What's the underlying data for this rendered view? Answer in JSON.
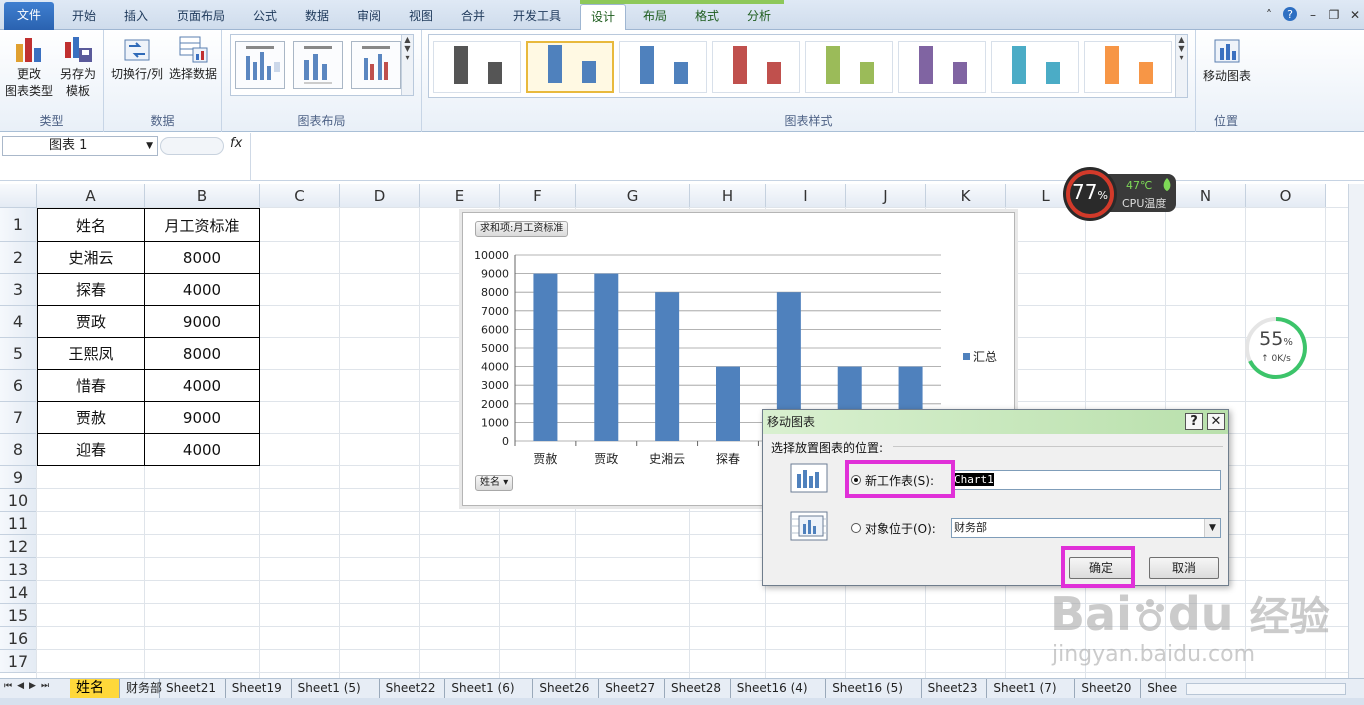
{
  "tabs": [
    "文件",
    "开始",
    "插入",
    "页面布局",
    "公式",
    "数据",
    "审阅",
    "视图",
    "合并",
    "开发工具",
    "设计",
    "布局",
    "格式",
    "分析"
  ],
  "ribbon": {
    "group_type": {
      "label": "类型",
      "change_type": "更改\n图表类型",
      "save_template": "另存为\n模板"
    },
    "group_data": {
      "label": "数据",
      "switch": "切换行/列",
      "select": "选择数据"
    },
    "group_layout": {
      "label": "图表布局"
    },
    "group_styles": {
      "label": "图表样式",
      "style_colors": [
        "#555555",
        "#4f81bd",
        "#4f81bd",
        "#c0504d",
        "#9bbb59",
        "#8064a2",
        "#4bacc6",
        "#f79646"
      ]
    },
    "group_location": {
      "label": "位置",
      "move_chart": "移动图表"
    }
  },
  "namebox": {
    "value": "图表 1"
  },
  "fx": "fx",
  "columns": [
    "A",
    "B",
    "C",
    "D",
    "E",
    "F",
    "G",
    "H",
    "I",
    "J",
    "K",
    "L",
    "M",
    "N",
    "O"
  ],
  "rows": [
    "1",
    "2",
    "3",
    "4",
    "5",
    "6",
    "7",
    "8",
    "9",
    "10",
    "11",
    "12",
    "13",
    "14",
    "15",
    "16",
    "17"
  ],
  "table": {
    "headers": [
      "姓名",
      "月工资标准"
    ],
    "rows": [
      [
        "史湘云",
        "8000"
      ],
      [
        "探春",
        "4000"
      ],
      [
        "贾政",
        "9000"
      ],
      [
        "王熙凤",
        "8000"
      ],
      [
        "惜春",
        "4000"
      ],
      [
        "贾赦",
        "9000"
      ],
      [
        "迎春",
        "4000"
      ]
    ]
  },
  "chart_data": {
    "type": "bar",
    "title": "",
    "value_field_button": "求和项:月工资标准",
    "axis_field_button": "姓名",
    "categories": [
      "贾赦",
      "贾政",
      "史湘云",
      "探春",
      "",
      "",
      ""
    ],
    "series": [
      {
        "name": "汇总",
        "values": [
          9000,
          9000,
          8000,
          4000,
          8000,
          4000,
          4000
        ],
        "color": "#4f81bd"
      }
    ],
    "ylim": [
      0,
      10000
    ],
    "yticks": [
      "10000",
      "9000",
      "8000",
      "7000",
      "6000",
      "5000",
      "4000",
      "3000",
      "2000",
      "1000",
      "0"
    ],
    "grid": true,
    "legend": "right"
  },
  "dialog": {
    "title": "移动图表",
    "help": "?",
    "close": "✕",
    "prompt": "选择放置图表的位置:",
    "opt_new": "新工作表(S):",
    "new_name": "Chart1",
    "opt_obj": "对象位于(O):",
    "obj_value": "财务部",
    "ok": "确定",
    "cancel": "取消"
  },
  "sheets": [
    "姓名",
    "财务部",
    "Sheet21",
    "Sheet19",
    "Sheet1 (5)",
    "Sheet22",
    "Sheet1 (6)",
    "Sheet26",
    "Sheet27",
    "Sheet28",
    "Sheet16 (4)",
    "Sheet16 (5)",
    "Sheet23",
    "Sheet1 (7)",
    "Sheet20",
    "Shee"
  ],
  "cpu_widget": {
    "usage": "77",
    "pct": "%",
    "temp": "47℃",
    "label": "CPU温度"
  },
  "net_widget": {
    "usage": "55",
    "pct": "%",
    "speed": "↑ 0K/s"
  },
  "watermark": {
    "brand": "Bai",
    "brand2": "du",
    "cn": "经验",
    "url": "jingyan.baidu.com"
  },
  "colors": {
    "accent": "#4f81bd",
    "highlight": "#e030d8",
    "active_sheet": "#ffd83a"
  }
}
